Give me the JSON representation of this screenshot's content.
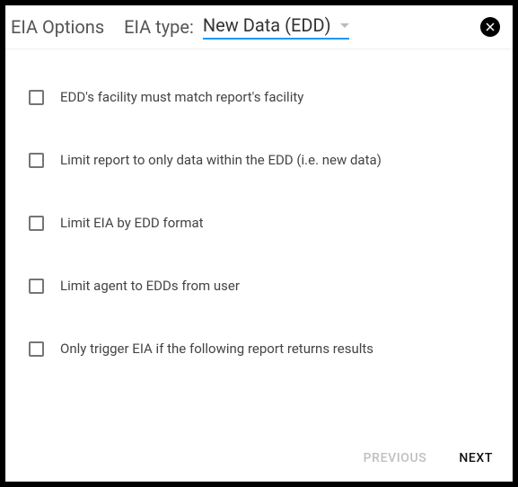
{
  "header": {
    "title": "EIA Options",
    "type_label": "EIA type:",
    "type_value": "New Data (EDD)"
  },
  "options": [
    {
      "label": "EDD's facility must match report's facility",
      "checked": false
    },
    {
      "label": "Limit report to only data within the EDD (i.e. new data)",
      "checked": false
    },
    {
      "label": "Limit EIA by EDD format",
      "checked": false
    },
    {
      "label": "Limit agent to EDDs from user",
      "checked": false
    },
    {
      "label": "Only trigger EIA if the following report returns results",
      "checked": false
    }
  ],
  "footer": {
    "previous": "Previous",
    "next": "Next"
  }
}
